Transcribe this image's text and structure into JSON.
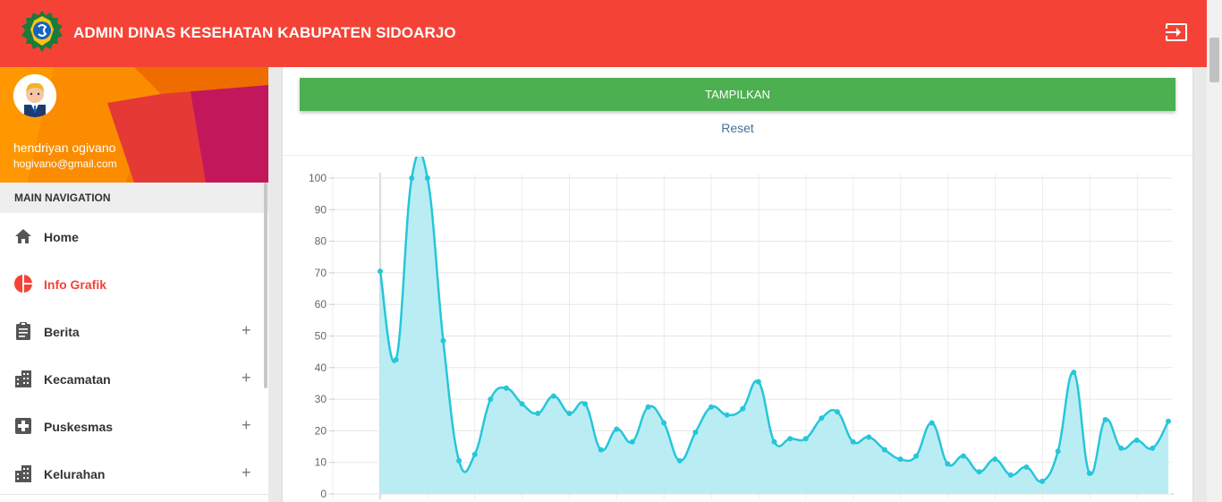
{
  "header": {
    "title": "ADMIN DINAS KESEHATAN KABUPATEN SIDOARJO",
    "logo_icon": "sidoarjo-emblem-icon",
    "logout_icon": "logout-icon",
    "bar_color": "#f44336"
  },
  "user": {
    "name": "hendriyan ogivano",
    "email": "hogivano@gmail.com"
  },
  "sidebar": {
    "nav_header": "MAIN NAVIGATION",
    "items": [
      {
        "label": "Home",
        "icon": "home-icon",
        "expandable": false,
        "active": false
      },
      {
        "label": "Info Grafik",
        "icon": "pie-chart-icon",
        "expandable": false,
        "active": true
      },
      {
        "label": "Berita",
        "icon": "clipboard-icon",
        "expandable": true,
        "active": false
      },
      {
        "label": "Kecamatan",
        "icon": "building-icon",
        "expandable": true,
        "active": false
      },
      {
        "label": "Puskesmas",
        "icon": "medical-cross-icon",
        "expandable": true,
        "active": false
      },
      {
        "label": "Kelurahan",
        "icon": "building-icon",
        "expandable": true,
        "active": false
      }
    ],
    "expand_symbol": "+"
  },
  "content": {
    "show_button": "TAMPILKAN",
    "reset_label": "Reset"
  },
  "colors": {
    "accent": "#f44336",
    "button": "#4caf50",
    "chart_line": "#26c6da",
    "chart_fill": "#b2ebf2"
  },
  "chart_data": {
    "type": "area",
    "ylim": [
      0,
      100
    ],
    "yticks": [
      0,
      10,
      20,
      30,
      40,
      50,
      60,
      70,
      80,
      90,
      100
    ],
    "grid": true,
    "series": [
      {
        "values": [
          70.5,
          42.5,
          100,
          100,
          48.5,
          10.5,
          12.5,
          30,
          33.5,
          28.5,
          25.5,
          31,
          25.5,
          28.5,
          14,
          20.5,
          16.5,
          27.5,
          22.5,
          10.5,
          19.5,
          27.5,
          25,
          27,
          35.5,
          16.5,
          17.5,
          17.5,
          24,
          26,
          16.5,
          18,
          14,
          11,
          12,
          22.5,
          9.5,
          12,
          7,
          11,
          6,
          8.5,
          4,
          13.5,
          38.5,
          6.5,
          23.5,
          14.5,
          17,
          14.5,
          23
        ]
      }
    ]
  }
}
